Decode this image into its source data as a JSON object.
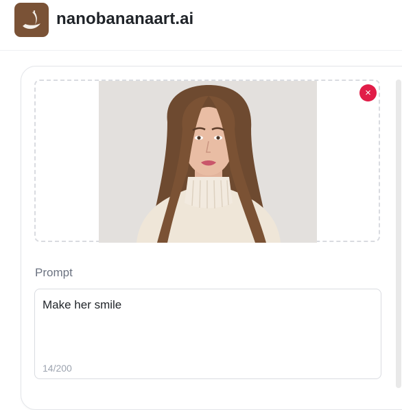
{
  "header": {
    "brand": "nanobananaart.ai",
    "logo_icon": "banana-icon"
  },
  "upload": {
    "image_alt": "Uploaded portrait photo",
    "remove_symbol": "×"
  },
  "prompt": {
    "label": "Prompt",
    "value": "Make her smile",
    "counter": "14/200"
  },
  "colors": {
    "logo_bg": "#7a5236",
    "remove_button": "#e11d48"
  }
}
